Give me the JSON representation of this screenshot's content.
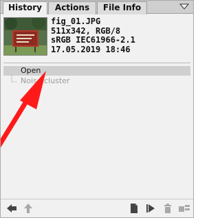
{
  "tabs": [
    {
      "label": "History",
      "active": true
    },
    {
      "label": "Actions",
      "active": false
    },
    {
      "label": "File Info",
      "active": false
    }
  ],
  "snapshot": {
    "filename": "fig_01.JPG",
    "dimensions": "511x342, RGB/8",
    "profile": "sRGB IEC61966-2.1",
    "datetime": "17.05.2019 18:46"
  },
  "history": [
    {
      "label": "Open",
      "selected": true,
      "enabled": true
    },
    {
      "label": "Noise cluster",
      "selected": false,
      "enabled": false
    }
  ],
  "toolbar": {
    "icons": [
      "undo-arrow-icon",
      "redo-arrow-icon",
      "new-document-icon",
      "play-step-icon",
      "trash-icon",
      "snapshot-icon"
    ]
  },
  "colors": {
    "annotation_arrow": "#ff1a1a",
    "selected_row": "#cfcfcf",
    "disabled_text": "#9a9a9a"
  }
}
